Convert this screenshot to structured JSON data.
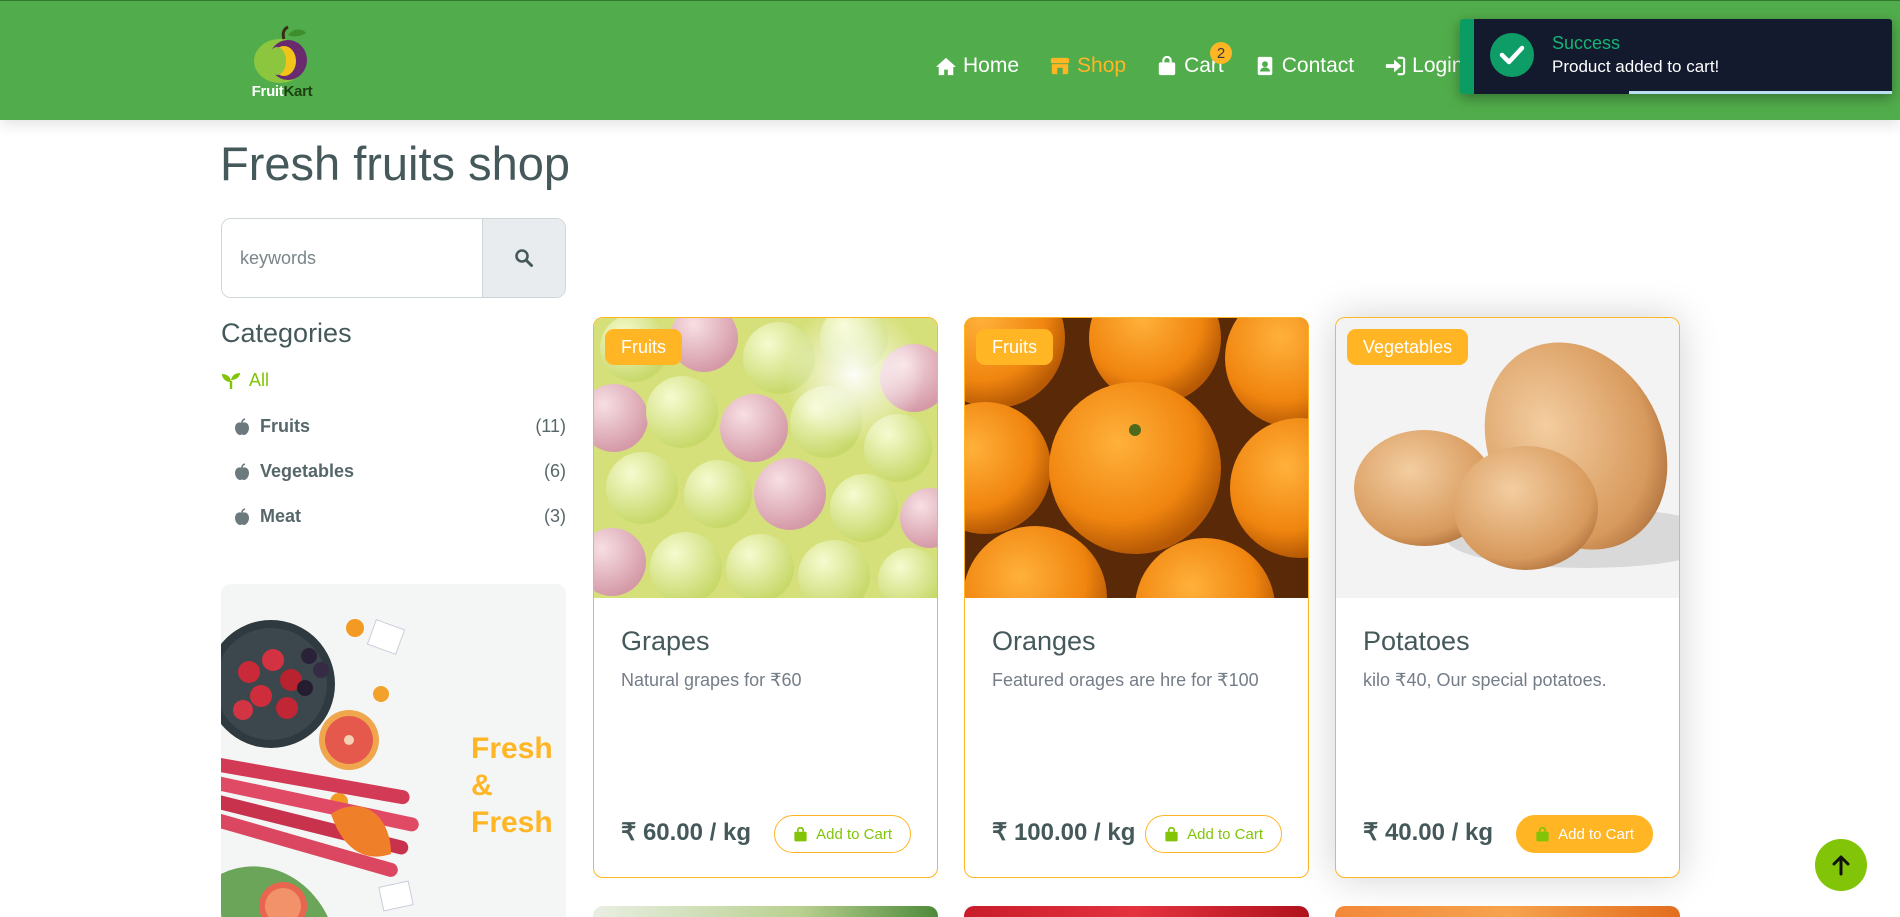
{
  "brand": {
    "name_part1": "Fruit",
    "name_part2": "Kart",
    "colors": {
      "primary_green": "#51ad4b",
      "accent": "#ffb524",
      "secondary": "#81c408",
      "text": "#45595b"
    }
  },
  "nav": {
    "items": [
      {
        "label": "Home",
        "icon": "home-icon"
      },
      {
        "label": "Shop",
        "icon": "shop-icon",
        "active": true
      },
      {
        "label": "Cart",
        "icon": "shopping-bag-icon",
        "badge": "2"
      },
      {
        "label": "Contact",
        "icon": "contact-card-icon"
      },
      {
        "label": "Login",
        "icon": "sign-in-icon"
      }
    ]
  },
  "toast": {
    "title": "Success",
    "message": "Product added to cart!",
    "icon": "check-circle-icon",
    "progress_fraction": 0.63
  },
  "page": {
    "title": "Fresh fruits shop"
  },
  "search": {
    "placeholder": "keywords",
    "value": "",
    "icon": "search-icon"
  },
  "categories": {
    "title": "Categories",
    "all_label": "All",
    "items": [
      {
        "name": "Fruits",
        "count": "(11)"
      },
      {
        "name": "Vegetables",
        "count": "(6)"
      },
      {
        "name": "Meat",
        "count": "(3)"
      }
    ]
  },
  "banner": {
    "line1": "Fresh",
    "line2": "&",
    "line3": "Fresh"
  },
  "products": [
    {
      "tag": "Fruits",
      "name": "Grapes",
      "description": "Natural grapes for ₹60",
      "price": "₹ 60.00 / kg",
      "button": "Add to Cart"
    },
    {
      "tag": "Fruits",
      "name": "Oranges",
      "description": "Featured orages are hre for ₹100",
      "price": "₹ 100.00 / kg",
      "button": "Add to Cart"
    },
    {
      "tag": "Vegetables",
      "name": "Potatoes",
      "description": "kilo ₹40, Our special potatoes.",
      "price": "₹ 40.00 / kg",
      "button": "Add to Cart"
    }
  ]
}
